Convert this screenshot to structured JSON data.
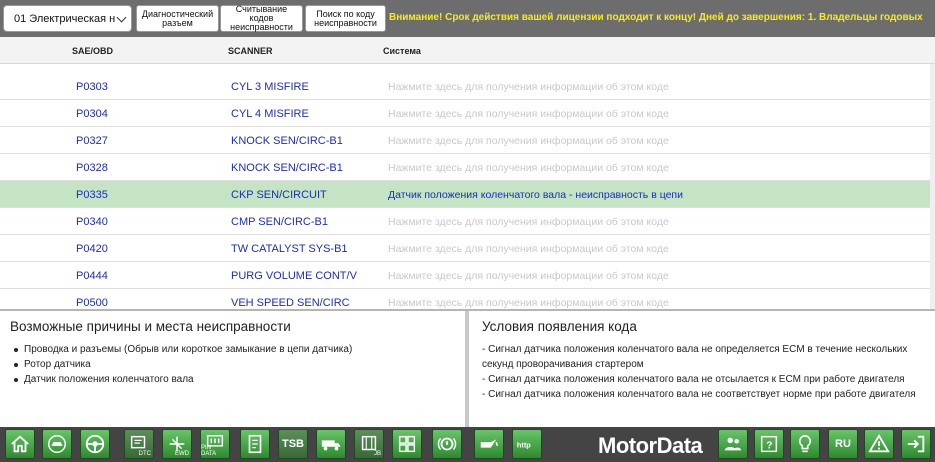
{
  "toolbar": {
    "system_select": "01 Электрическая н",
    "buttons": [
      {
        "label": "Диагностический\nразъем"
      },
      {
        "label": "Считывание\nкодов\nнеисправности"
      },
      {
        "label": "Поиск по коду\nнеисправности"
      }
    ],
    "notice": "Внимание! Срок действия вашей лицензии подходит к концу! Дней до завершения: 1. Владельцы годовых"
  },
  "table": {
    "columns": [
      "SAE/OBD",
      "SCANNER",
      "Система"
    ],
    "placeholder": "Нажмите здесь для получения информации об этом коде",
    "rows": [
      {
        "code": "P0303",
        "scanner": "CYL 3 MISFIRE",
        "system": "Нажмите здесь для получения информации об этом коде"
      },
      {
        "code": "P0304",
        "scanner": "CYL 4 MISFIRE",
        "system": "Нажмите здесь для получения информации об этом коде"
      },
      {
        "code": "P0327",
        "scanner": "KNOCK SEN/CIRC-B1",
        "system": "Нажмите здесь для получения информации об этом коде"
      },
      {
        "code": "P0328",
        "scanner": "KNOCK SEN/CIRC-B1",
        "system": "Нажмите здесь для получения информации об этом коде"
      },
      {
        "code": "P0335",
        "scanner": "CKP SEN/CIRCUIT",
        "system": "Датчик положения коленчатого вала - неисправность в цепи"
      },
      {
        "code": "P0340",
        "scanner": "CMP SEN/CIRC-B1",
        "system": "Нажмите здесь для получения информации об этом коде"
      },
      {
        "code": "P0420",
        "scanner": "TW CATALYST SYS-B1",
        "system": "Нажмите здесь для получения информации об этом коде"
      },
      {
        "code": "P0444",
        "scanner": "PURG VOLUME CONT/V",
        "system": "Нажмите здесь для получения информации об этом коде"
      },
      {
        "code": "P0500",
        "scanner": "VEH SPEED SEN/CIRC",
        "system": "Нажмите здесь для получения информации об этом коде"
      }
    ]
  },
  "causes": {
    "title": "Возможные причины и места неисправности",
    "items": [
      "Проводка и разъемы (Обрыв или короткое замыкание в цепи датчика)",
      "Ротор датчика",
      "Датчик положения коленчатого вала"
    ]
  },
  "conditions": {
    "title": "Условия появления кода",
    "lines": [
      "- Сигнал датчика положения коленчатого вала не определяется ECM в течение нескольких секунд проворачивания стартером",
      "- Сигнал датчика положения коленчатого вала не отсылается к ECM при работе двигателя",
      "- Сигнал датчика положения коленчатого вала не соответствует норме при работе двигателя"
    ]
  },
  "bottom_toolbar": {
    "brand": "MotorData",
    "icons": [
      {
        "name": "home-icon"
      },
      {
        "name": "vehicle-icon"
      },
      {
        "name": "steering-wheel-icon"
      },
      {
        "name": "dtc-icon",
        "label": "DTC"
      },
      {
        "name": "ewd-icon",
        "label": "EWD"
      },
      {
        "name": "pin-data-icon",
        "label": "PIN DATA"
      },
      {
        "name": "document-icon"
      },
      {
        "name": "tsb-icon",
        "label": "TSB"
      },
      {
        "name": "truck-icon"
      },
      {
        "name": "jb-icon",
        "label": "JB"
      },
      {
        "name": "grid-icon"
      },
      {
        "name": "brake-icon"
      },
      {
        "name": "oil-can-icon"
      },
      {
        "name": "http-icon"
      },
      {
        "name": "people-icon"
      },
      {
        "name": "help-book-icon"
      },
      {
        "name": "lightbulb-icon"
      },
      {
        "name": "language-icon",
        "label": "RU"
      },
      {
        "name": "warning-icon"
      },
      {
        "name": "exit-icon"
      }
    ]
  }
}
